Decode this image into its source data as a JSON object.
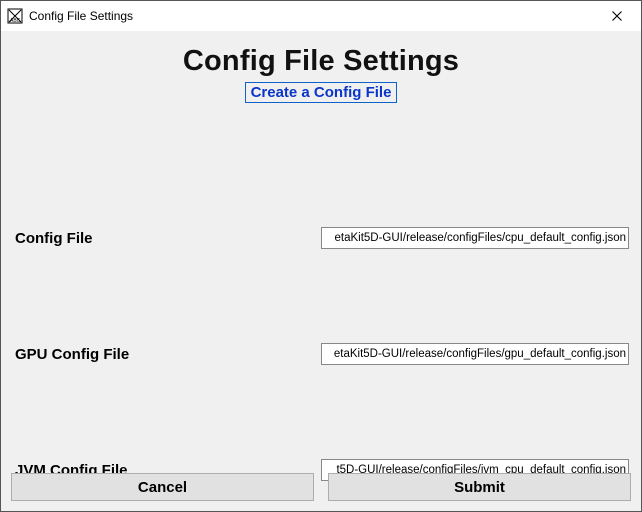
{
  "window": {
    "title": "Config File Settings"
  },
  "heading": "Config File Settings",
  "link": {
    "create": "Create a Config File"
  },
  "fields": {
    "config": {
      "label": "Config File",
      "value": "etaKit5D-GUI/release/configFiles/cpu_default_config.json"
    },
    "gpu": {
      "label": "GPU Config File",
      "value": "etaKit5D-GUI/release/configFiles/gpu_default_config.json"
    },
    "jvm": {
      "label": "JVM Config File",
      "value": "t5D-GUI/release/configFiles/jvm_cpu_default_config.json"
    }
  },
  "buttons": {
    "cancel": "Cancel",
    "submit": "Submit"
  }
}
